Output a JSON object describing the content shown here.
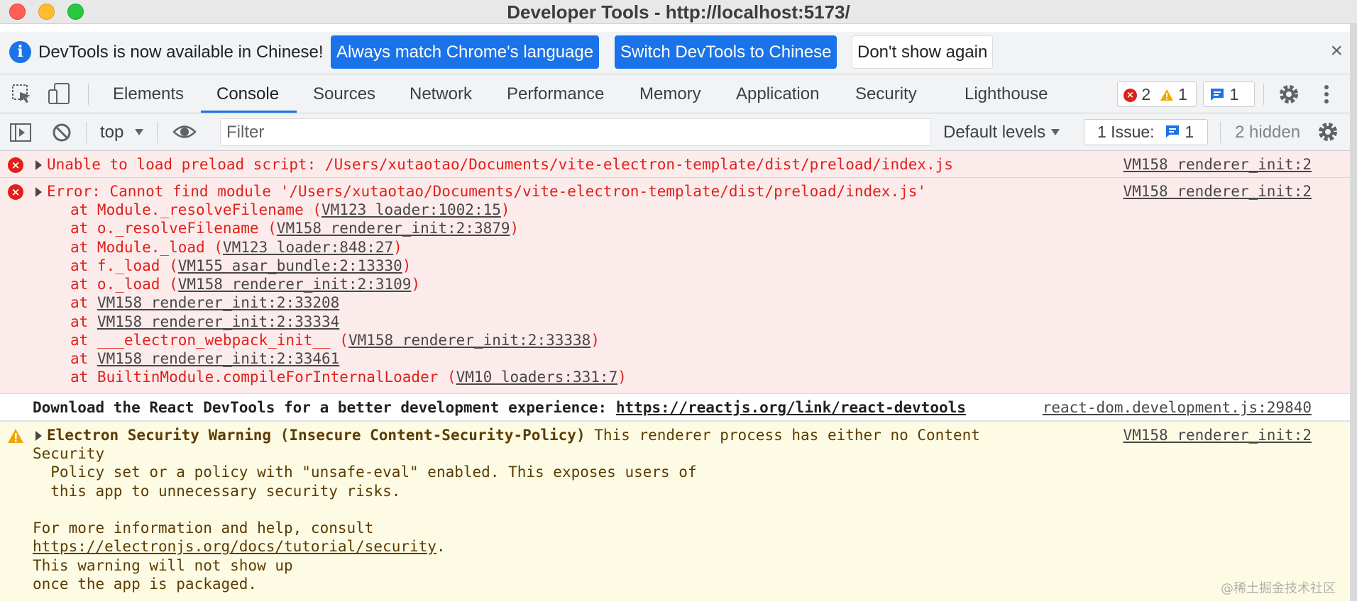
{
  "window": {
    "title": "Developer Tools - http://localhost:5173/"
  },
  "infobar": {
    "message": "DevTools is now available in Chinese!",
    "btn_match": "Always match Chrome's language",
    "btn_switch": "Switch DevTools to Chinese",
    "btn_dont_show": "Don't show again",
    "close": "×"
  },
  "tabs": [
    "Elements",
    "Console",
    "Sources",
    "Network",
    "Performance",
    "Memory",
    "Application",
    "Security",
    "Lighthouse"
  ],
  "counters": {
    "errors": "2",
    "warnings": "1",
    "messages": "1"
  },
  "console_toolbar": {
    "context": "top",
    "filter_placeholder": "Filter",
    "levels": "Default levels",
    "issues_label": "1 Issue:",
    "issues_count": "1",
    "hidden": "2 hidden"
  },
  "log": {
    "err1": {
      "text": "Unable to load preload script: /Users/xutaotao/Documents/vite-electron-template/dist/preload/index.js",
      "source": "VM158 renderer_init:2"
    },
    "err2": {
      "text": "Error: Cannot find module '/Users/xutaotao/Documents/vite-electron-template/dist/preload/index.js'",
      "source": "VM158 renderer_init:2",
      "stack": [
        {
          "prefix": "at Module._resolveFilename (",
          "link": "VM123 loader:1002:15",
          "suffix": ")"
        },
        {
          "prefix": "at o._resolveFilename (",
          "link": "VM158 renderer_init:2:3879",
          "suffix": ")"
        },
        {
          "prefix": "at Module._load (",
          "link": "VM123 loader:848:27",
          "suffix": ")"
        },
        {
          "prefix": "at f._load (",
          "link": "VM155 asar_bundle:2:13330",
          "suffix": ")"
        },
        {
          "prefix": "at o._load (",
          "link": "VM158 renderer_init:2:3109",
          "suffix": ")"
        },
        {
          "prefix": "at ",
          "link": "VM158 renderer_init:2:33208",
          "suffix": ""
        },
        {
          "prefix": "at ",
          "link": "VM158 renderer_init:2:33334",
          "suffix": ""
        },
        {
          "prefix": "at ___electron_webpack_init__ (",
          "link": "VM158 renderer_init:2:33338",
          "suffix": ")"
        },
        {
          "prefix": "at ",
          "link": "VM158 renderer_init:2:33461",
          "suffix": ""
        },
        {
          "prefix": "at BuiltinModule.compileForInternalLoader (",
          "link": "VM10 loaders:331:7",
          "suffix": ")"
        }
      ]
    },
    "info": {
      "text": "Download the React DevTools for a better development experience: ",
      "link": "https://reactjs.org/link/react-devtools",
      "source": "react-dom.development.js:29840"
    },
    "warn": {
      "title": "Electron Security Warning (Insecure Content-Security-Policy)",
      "text1": " This renderer process has either no Content",
      "line2": "Security",
      "line3": "  Policy set or a policy with \"unsafe-eval\" enabled. This exposes users of",
      "line4": "  this app to unnecessary security risks.",
      "line6": "For more information and help, consult",
      "link": "https://electronjs.org/docs/tutorial/security",
      "link_suffix": ".",
      "line8": "This warning will not show up",
      "line9": "once the app is packaged.",
      "source": "VM158 renderer_init:2"
    }
  },
  "watermark": "@稀土掘金技术社区",
  "colors": {
    "accent": "#1a73e8",
    "error": "#e0201a",
    "warning": "#f2a600"
  }
}
